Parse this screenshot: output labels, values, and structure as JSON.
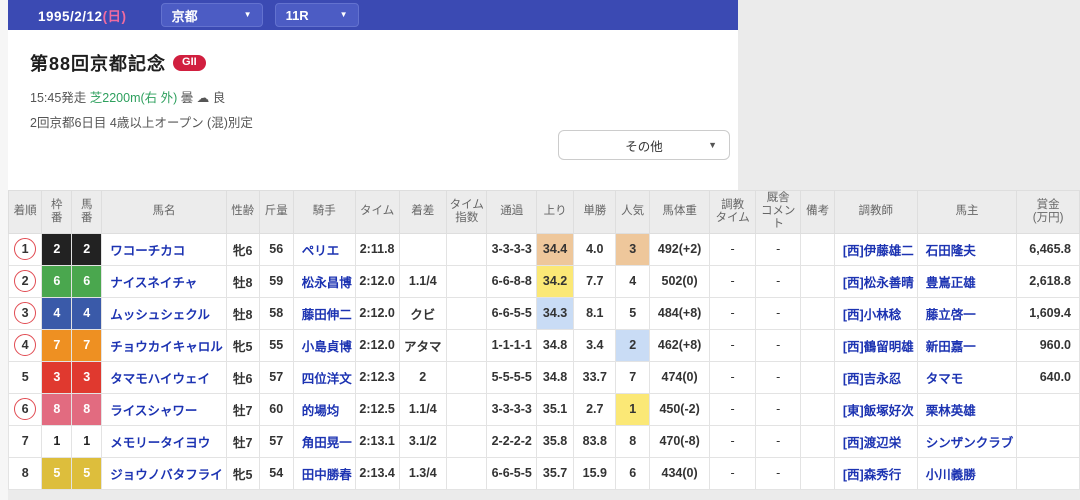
{
  "topbar": {
    "date": "1995/2/12",
    "day": "(日)",
    "venue": "京都",
    "race": "11R",
    "caret": "▼"
  },
  "race": {
    "title": "第88回京都記念",
    "grade": "GII",
    "start": "15:45発走",
    "course": "芝2200m(右 外)",
    "weather": "曇",
    "cloud": "☁",
    "going": "良",
    "meet": "2回京都6日目 4歳以上オープン (混)別定",
    "other": "その他",
    "caret": "▼"
  },
  "table": {
    "headers": [
      "着順",
      "枠\n番",
      "馬\n番",
      "馬名",
      "性齢",
      "斤量",
      "騎手",
      "タイム",
      "着差",
      "タイム\n指数",
      "通過",
      "上り",
      "単勝",
      "人気",
      "馬体重",
      "調教\nタイム",
      "厩舎\nコメン\nト",
      "備考",
      "調教師",
      "馬主",
      "賞金\n(万円)"
    ],
    "rows": [
      {
        "pos": "1",
        "circled": true,
        "frame": "2",
        "waku": "2",
        "umaban": "2",
        "name": "ワコーチカコ",
        "sexage": "牝6",
        "weight": "56",
        "jockey": "ペリエ",
        "time": "2:11.8",
        "margin": "",
        "index": "",
        "passing": "3-3-3-3",
        "agari": "34.4",
        "agari_hl": "rank3",
        "odds": "4.0",
        "pop": "3",
        "pop_hl": "rank3",
        "hweight": "492(+2)",
        "train": "-",
        "comment": "-",
        "note": "",
        "trainer": "[西]伊藤雄二",
        "owner": "石田隆夫",
        "prize": "6,465.8"
      },
      {
        "pos": "2",
        "circled": true,
        "frame": "6",
        "waku": "6",
        "umaban": "6",
        "name": "ナイスネイチャ",
        "sexage": "牡8",
        "weight": "59",
        "jockey": "松永昌博",
        "time": "2:12.0",
        "margin": "1.1/4",
        "index": "",
        "passing": "6-6-8-8",
        "agari": "34.2",
        "agari_hl": "rank1",
        "odds": "7.7",
        "pop": "4",
        "pop_hl": "",
        "hweight": "502(0)",
        "train": "-",
        "comment": "-",
        "note": "",
        "trainer": "[西]松永善晴",
        "owner": "豊嶌正雄",
        "prize": "2,618.8"
      },
      {
        "pos": "3",
        "circled": true,
        "frame": "4",
        "waku": "4",
        "umaban": "4",
        "name": "ムッシュシェクル",
        "sexage": "牡8",
        "weight": "58",
        "jockey": "藤田伸二",
        "time": "2:12.0",
        "margin": "クビ",
        "index": "",
        "passing": "6-6-5-5",
        "agari": "34.3",
        "agari_hl": "rank2",
        "odds": "8.1",
        "pop": "5",
        "pop_hl": "",
        "hweight": "484(+8)",
        "train": "-",
        "comment": "-",
        "note": "",
        "trainer": "[西]小林稔",
        "owner": "藤立啓一",
        "prize": "1,609.4"
      },
      {
        "pos": "4",
        "circled": true,
        "frame": "7",
        "waku": "7",
        "umaban": "7",
        "name": "チョウカイキャロル",
        "sexage": "牝5",
        "weight": "55",
        "jockey": "小島貞博",
        "time": "2:12.0",
        "margin": "アタマ",
        "index": "",
        "passing": "1-1-1-1",
        "agari": "34.8",
        "agari_hl": "",
        "odds": "3.4",
        "pop": "2",
        "pop_hl": "rank2",
        "hweight": "462(+8)",
        "train": "-",
        "comment": "-",
        "note": "",
        "trainer": "[西]鶴留明雄",
        "owner": "新田嘉一",
        "prize": "960.0"
      },
      {
        "pos": "5",
        "circled": false,
        "frame": "3",
        "waku": "3",
        "umaban": "3",
        "name": "タマモハイウェイ",
        "sexage": "牡6",
        "weight": "57",
        "jockey": "四位洋文",
        "time": "2:12.3",
        "margin": "2",
        "index": "",
        "passing": "5-5-5-5",
        "agari": "34.8",
        "agari_hl": "",
        "odds": "33.7",
        "pop": "7",
        "pop_hl": "",
        "hweight": "474(0)",
        "train": "-",
        "comment": "-",
        "note": "",
        "trainer": "[西]吉永忍",
        "owner": "タマモ",
        "prize": "640.0"
      },
      {
        "pos": "6",
        "circled": true,
        "frame": "8",
        "waku": "8",
        "umaban": "8",
        "name": "ライスシャワー",
        "sexage": "牡7",
        "weight": "60",
        "jockey": "的場均",
        "time": "2:12.5",
        "margin": "1.1/4",
        "index": "",
        "passing": "3-3-3-3",
        "agari": "35.1",
        "agari_hl": "",
        "odds": "2.7",
        "pop": "1",
        "pop_hl": "rank1",
        "hweight": "450(-2)",
        "train": "-",
        "comment": "-",
        "note": "",
        "trainer": "[東]飯塚好次",
        "owner": "栗林英雄",
        "prize": ""
      },
      {
        "pos": "7",
        "circled": false,
        "frame": "1",
        "waku": "1",
        "umaban": "1",
        "name": "メモリータイヨウ",
        "sexage": "牡7",
        "weight": "57",
        "jockey": "角田晃一",
        "time": "2:13.1",
        "margin": "3.1/2",
        "index": "",
        "passing": "2-2-2-2",
        "agari": "35.8",
        "agari_hl": "",
        "odds": "83.8",
        "pop": "8",
        "pop_hl": "",
        "hweight": "470(-8)",
        "train": "-",
        "comment": "-",
        "note": "",
        "trainer": "[西]渡辺栄",
        "owner": "シンザンクラブ",
        "prize": ""
      },
      {
        "pos": "8",
        "circled": false,
        "frame": "5",
        "waku": "5",
        "umaban": "5",
        "name": "ジョウノバタフライ",
        "sexage": "牝5",
        "weight": "54",
        "jockey": "田中勝春",
        "time": "2:13.4",
        "margin": "1.3/4",
        "index": "",
        "passing": "6-6-5-5",
        "agari": "35.7",
        "agari_hl": "",
        "odds": "15.9",
        "pop": "6",
        "pop_hl": "",
        "hweight": "434(0)",
        "train": "-",
        "comment": "-",
        "note": "",
        "trainer": "[西]森秀行",
        "owner": "小川義勝",
        "prize": ""
      }
    ]
  },
  "colors": {
    "topbar_blue": "#3b4ab3",
    "link_blue": "#1c33b2",
    "grade_red": "#d11f3f",
    "course_green": "#2ea05e",
    "highlight": {
      "rank1": "#fbe876",
      "rank2": "#c9dcf5",
      "rank3": "#eec79b"
    },
    "frames": {
      "1": {
        "bg": "#ffffff",
        "fg": "#222222"
      },
      "2": {
        "bg": "#222222",
        "fg": "#ffffff"
      },
      "3": {
        "bg": "#e0392f",
        "fg": "#ffffff"
      },
      "4": {
        "bg": "#3a5aa9",
        "fg": "#ffffff"
      },
      "5": {
        "bg": "#ddbe3c",
        "fg": "#ffffff"
      },
      "6": {
        "bg": "#4aa74e",
        "fg": "#ffffff"
      },
      "7": {
        "bg": "#ee9022",
        "fg": "#ffffff"
      },
      "8": {
        "bg": "#e26b80",
        "fg": "#ffffff"
      }
    }
  }
}
